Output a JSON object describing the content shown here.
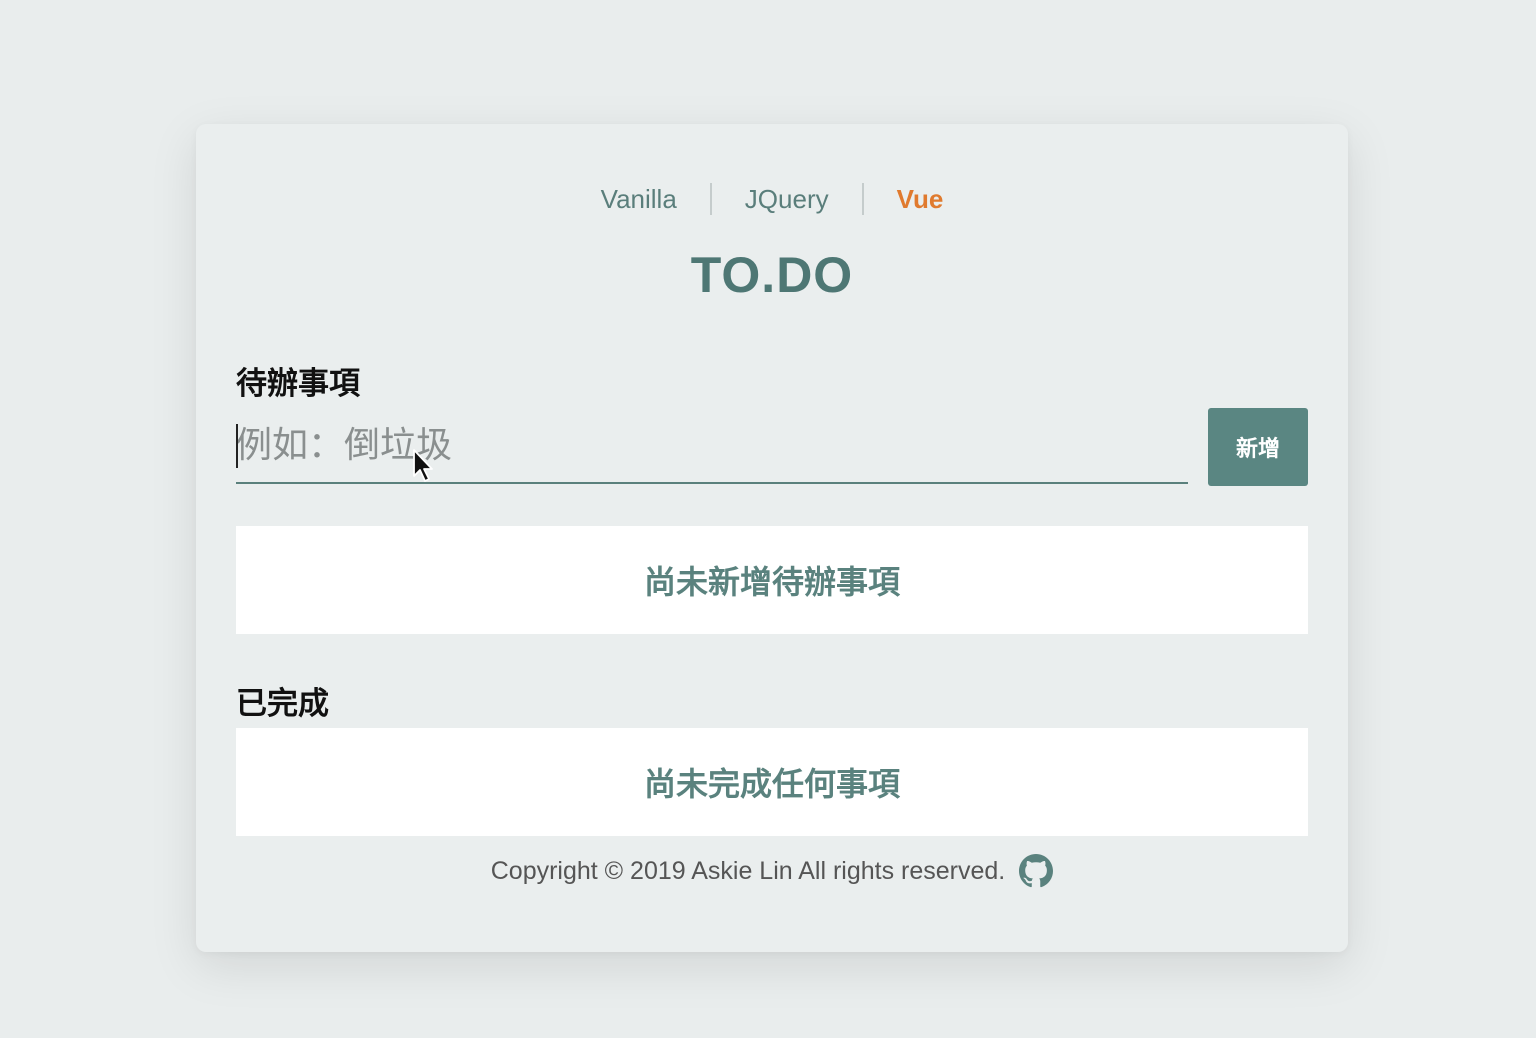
{
  "nav": {
    "items": [
      {
        "label": "Vanilla",
        "active": false
      },
      {
        "label": "JQuery",
        "active": false
      },
      {
        "label": "Vue",
        "active": true
      }
    ]
  },
  "title": "TO.DO",
  "todo": {
    "label": "待辦事項",
    "input_value": "",
    "placeholder": "例如：倒垃圾",
    "add_button": "新增",
    "empty_text": "尚未新增待辦事項"
  },
  "done": {
    "label": "已完成",
    "empty_text": "尚未完成任何事項"
  },
  "footer": {
    "copyright": "Copyright © 2019 Askie Lin All rights reserved.",
    "icon": "github-icon"
  },
  "colors": {
    "accent": "#5a8682",
    "active_nav": "#e07a2e",
    "background": "#e9eded"
  }
}
